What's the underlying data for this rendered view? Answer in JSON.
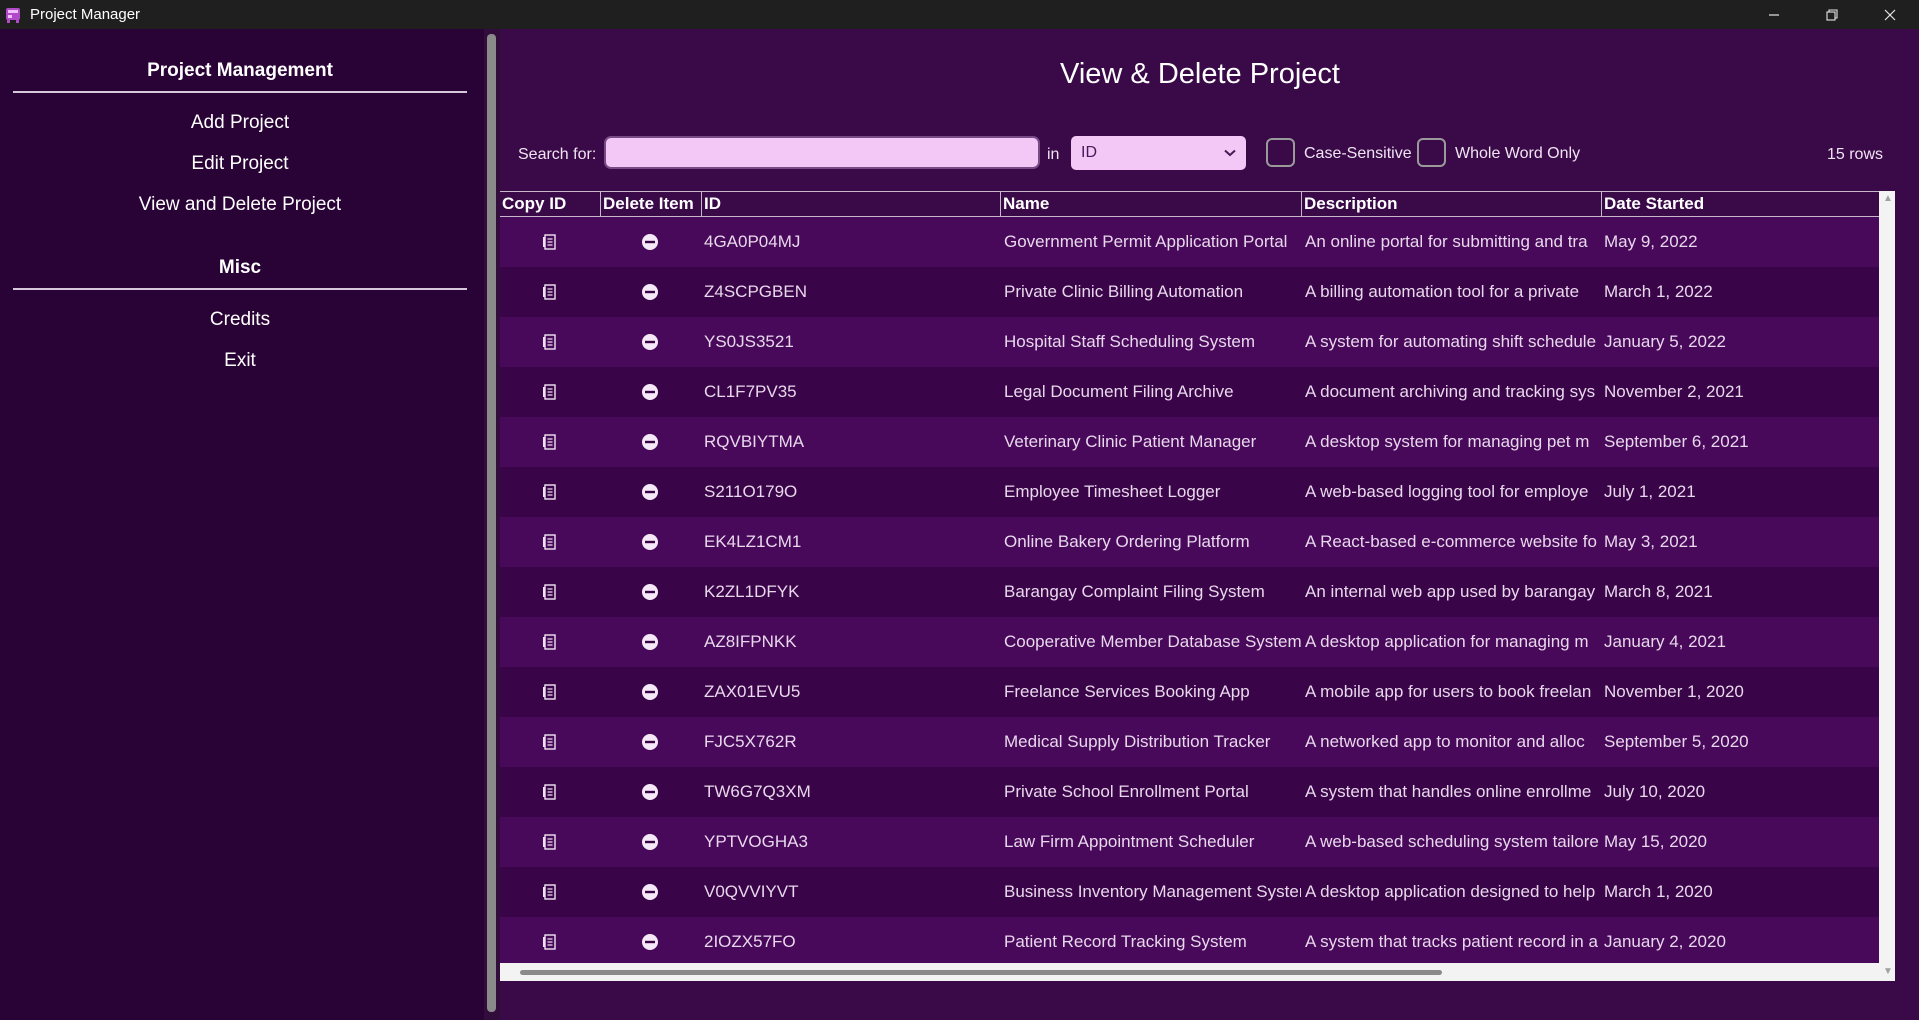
{
  "window": {
    "title": "Project Manager",
    "controls": [
      "minimize-icon",
      "restore-icon",
      "close-icon"
    ]
  },
  "sidebar": {
    "sections": [
      {
        "heading": "Project Management",
        "items": [
          "Add Project",
          "Edit Project",
          "View and Delete Project"
        ]
      },
      {
        "heading": "Misc",
        "items": [
          "Credits",
          "Exit"
        ]
      }
    ]
  },
  "main": {
    "title": "View & Delete Project",
    "search": {
      "label": "Search for:",
      "value": "",
      "in_label": "in",
      "field_selected": "ID",
      "case_sensitive_label": "Case-Sensitive",
      "case_sensitive_checked": false,
      "whole_word_label": "Whole Word Only",
      "whole_word_checked": false,
      "rows_count": "15 rows"
    },
    "table": {
      "columns": [
        "Copy ID",
        "Delete Item",
        "ID",
        "Name",
        "Description",
        "Date Started"
      ],
      "rows": [
        {
          "id": "4GA0P04MJ",
          "name": "Government Permit Application Portal",
          "description": "An online portal for submitting and tra",
          "date": "May 9, 2022"
        },
        {
          "id": "Z4SCPGBEN",
          "name": "Private Clinic Billing Automation",
          "description": "A billing automation tool for a private",
          "date": "March 1, 2022"
        },
        {
          "id": "YS0JS3521",
          "name": "Hospital Staff Scheduling System",
          "description": "A system for automating shift schedule",
          "date": "January 5, 2022"
        },
        {
          "id": "CL1F7PV35",
          "name": "Legal Document Filing Archive",
          "description": "A document archiving and tracking sys",
          "date": "November 2, 2021"
        },
        {
          "id": "RQVBIYTMA",
          "name": "Veterinary Clinic Patient Manager",
          "description": "A desktop system for managing pet m",
          "date": "September 6, 2021"
        },
        {
          "id": "S211O179O",
          "name": "Employee Timesheet Logger",
          "description": "A web-based logging tool for employe",
          "date": "July 1, 2021"
        },
        {
          "id": "EK4LZ1CM1",
          "name": "Online Bakery Ordering Platform",
          "description": "A React-based e-commerce website fo",
          "date": "May 3, 2021"
        },
        {
          "id": "K2ZL1DFYK",
          "name": "Barangay Complaint Filing System",
          "description": "An internal web app used by barangay",
          "date": "March 8, 2021"
        },
        {
          "id": "AZ8IFPNKK",
          "name": "Cooperative Member Database System",
          "description": "A desktop application for managing m",
          "date": "January 4, 2021"
        },
        {
          "id": "ZAX01EVU5",
          "name": "Freelance Services Booking App",
          "description": "A mobile app for users to book freelan",
          "date": "November 1, 2020"
        },
        {
          "id": "FJC5X762R",
          "name": "Medical Supply Distribution Tracker",
          "description": "A networked app to monitor and alloc",
          "date": "September 5, 2020"
        },
        {
          "id": "TW6G7Q3XM",
          "name": "Private School Enrollment Portal",
          "description": "A system that handles online enrollme",
          "date": "July 10, 2020"
        },
        {
          "id": "YPTVOGHA3",
          "name": "Law Firm Appointment Scheduler",
          "description": "A web-based scheduling system tailore",
          "date": "May 15, 2020"
        },
        {
          "id": "V0QVVIYVT",
          "name": "Business Inventory Management System",
          "description": "A desktop application designed to help",
          "date": "March 1, 2020"
        },
        {
          "id": "2IOZX57FO",
          "name": "Patient Record Tracking System",
          "description": "A system that tracks patient record in a",
          "date": "January 2, 2020"
        }
      ]
    }
  },
  "colors": {
    "sidebar_bg": "#290335",
    "main_bg": "#3a0a48",
    "row_odd": "#48095a",
    "row_even": "#3a0548",
    "input_bg": "#f3c8f7"
  }
}
